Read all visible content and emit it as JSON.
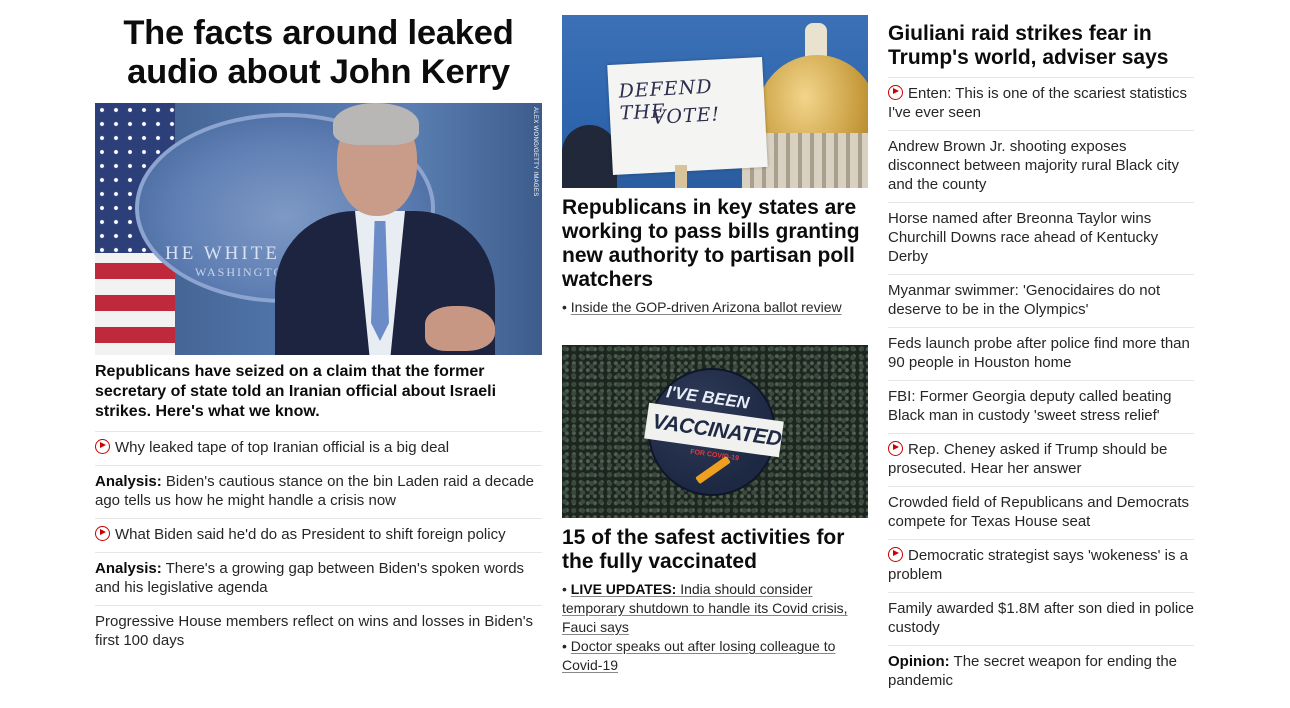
{
  "col1": {
    "headline": "The facts around leaked audio about John Kerry",
    "image": {
      "alt": "John Kerry speaking at the White House briefing room",
      "credit": "ALEX WONG/GETTY IMAGES",
      "backdrop_text": "HE WHITE H",
      "backdrop_sub": "WASHINGTO"
    },
    "summary": "Republicans have seized on a claim that the former secretary of state told an Iranian official about Israeli strikes. Here's what we know.",
    "links": [
      {
        "video": true,
        "prefix": "",
        "text": "Why leaked tape of top Iranian official is a big deal"
      },
      {
        "video": false,
        "prefix": "Analysis:",
        "text": " Biden's cautious stance on the bin Laden raid a decade ago tells us how he might handle a crisis now"
      },
      {
        "video": true,
        "prefix": "",
        "text": "What Biden said he'd do as President to shift foreign policy"
      },
      {
        "video": false,
        "prefix": "Analysis:",
        "text": " There's a growing gap between Biden's spoken words and his legislative agenda"
      },
      {
        "video": false,
        "prefix": "",
        "text": "Progressive House members reflect on wins and losses in Biden's first 100 days"
      }
    ]
  },
  "col2": {
    "card1": {
      "image": {
        "alt": "Defend the vote sign in front of the Georgia State Capitol",
        "sign_line1": "DEFEND  THE",
        "sign_line2": "VOTE!"
      },
      "headline": "Republicans in key states are working to pass bills granting new authority to partisan poll watchers",
      "sublinks": [
        {
          "prefix": "",
          "text": "Inside the GOP-driven Arizona ballot review"
        }
      ]
    },
    "card2": {
      "image": {
        "alt": "I've been vaccinated for Covid-19 button",
        "badge_line1": "I'VE BEEN",
        "badge_line2": "VACCINATED",
        "badge_line3": "FOR COVID-19"
      },
      "headline": "15 of the safest activities for the fully vaccinated",
      "sublinks": [
        {
          "prefix": "LIVE UPDATES:",
          "text": " India should consider temporary shutdown to handle its Covid crisis, Fauci says"
        },
        {
          "prefix": "",
          "text": "Doctor speaks out after losing colleague to Covid-19"
        }
      ]
    }
  },
  "col3": {
    "headline": "Giuliani raid strikes fear in Trump's world, adviser says",
    "links": [
      {
        "video": true,
        "prefix": "",
        "text": "Enten: This is one of the scariest statistics I've ever seen"
      },
      {
        "video": false,
        "prefix": "",
        "text": "Andrew Brown Jr. shooting exposes disconnect between majority rural Black city and the county"
      },
      {
        "video": false,
        "prefix": "",
        "text": "Horse named after Breonna Taylor wins Churchill Downs race ahead of Kentucky Derby"
      },
      {
        "video": false,
        "prefix": "",
        "text": "Myanmar swimmer: 'Genocidaires do not deserve to be in the Olympics'"
      },
      {
        "video": false,
        "prefix": "",
        "text": "Feds launch probe after police find more than 90 people in Houston home"
      },
      {
        "video": false,
        "prefix": "",
        "text": "FBI: Former Georgia deputy called beating Black man in custody 'sweet stress relief'"
      },
      {
        "video": true,
        "prefix": "",
        "text": "Rep. Cheney asked if Trump should be prosecuted. Hear her answer"
      },
      {
        "video": false,
        "prefix": "",
        "text": "Crowded field of Republicans and Democrats compete for Texas House seat"
      },
      {
        "video": true,
        "prefix": "",
        "text": "Democratic strategist says 'wokeness' is a problem"
      },
      {
        "video": false,
        "prefix": "",
        "text": "Family awarded $1.8M after son died in police custody"
      },
      {
        "video": false,
        "prefix": "Opinion:",
        "text": " The secret weapon for ending the pandemic"
      }
    ]
  },
  "colors": {
    "accent_red": "#cc0000",
    "text": "#262626",
    "divider": "#e6e6e6"
  }
}
